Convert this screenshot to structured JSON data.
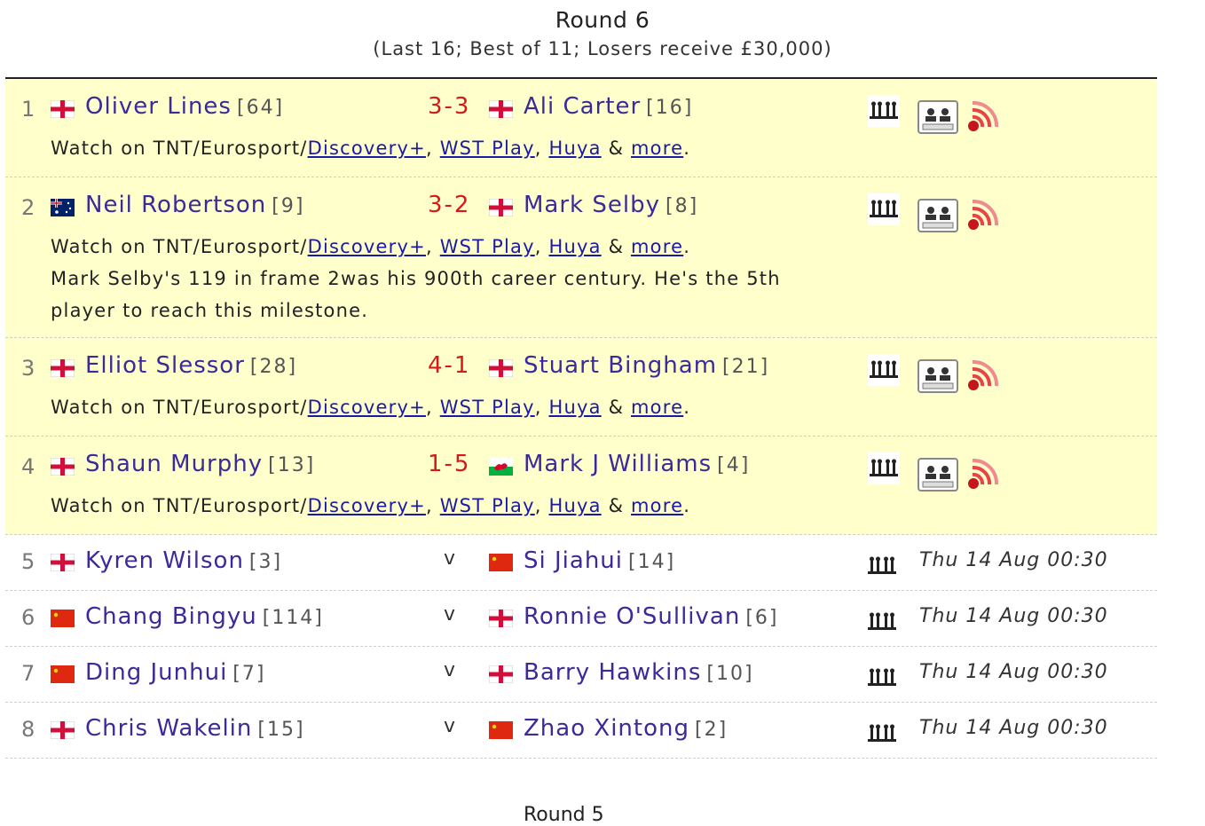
{
  "round": {
    "title": "Round 6",
    "subtitle": "(Last 16; Best of 11; Losers receive £30,000)",
    "next_title": "Round 5"
  },
  "colors": {
    "live_bg": "#ffffcc",
    "player": "#3a2a9a",
    "score": "#d41a1a",
    "link": "#1a1aa6"
  },
  "icons": {
    "h2h": "head-to-head-icon",
    "scorecard": "scorecard-icon",
    "live": "live-score-icon"
  },
  "watch": {
    "prefix": "Watch on TNT/Eurosport/",
    "links": [
      "Discovery+",
      "WST Play",
      "Huya",
      "more"
    ],
    "sep1": ", ",
    "sep2": ", ",
    "sep3": " & ",
    "end": "."
  },
  "matches": [
    {
      "num": "1",
      "player_a": "Oliver Lines",
      "seed_a": "[64]",
      "flag_a": "england",
      "score": "3-3",
      "player_b": "Ali Carter",
      "seed_b": "[16]",
      "flag_b": "england",
      "live": true
    },
    {
      "num": "2",
      "player_a": "Neil Robertson",
      "seed_a": "[9]",
      "flag_a": "australia",
      "score": "3-2",
      "player_b": "Mark Selby",
      "seed_b": "[8]",
      "flag_b": "england",
      "live": true,
      "note": "Mark Selby's 119 in frame 2was his 900th career century. He's the 5th player to reach this milestone."
    },
    {
      "num": "3",
      "player_a": "Elliot Slessor",
      "seed_a": "[28]",
      "flag_a": "england",
      "score": "4-1",
      "player_b": "Stuart Bingham",
      "seed_b": "[21]",
      "flag_b": "england",
      "live": true
    },
    {
      "num": "4",
      "player_a": "Shaun Murphy",
      "seed_a": "[13]",
      "flag_a": "england",
      "score": "1-5",
      "player_b": "Mark J Williams",
      "seed_b": "[4]",
      "flag_b": "wales",
      "live": true
    },
    {
      "num": "5",
      "player_a": "Kyren Wilson",
      "seed_a": "[3]",
      "flag_a": "england",
      "vs": "v",
      "player_b": "Si Jiahui",
      "seed_b": "[14]",
      "flag_b": "china",
      "time": "Thu 14 Aug 00:30"
    },
    {
      "num": "6",
      "player_a": "Chang Bingyu",
      "seed_a": "[114]",
      "flag_a": "china",
      "vs": "v",
      "player_b": "Ronnie O'Sullivan",
      "seed_b": "[6]",
      "flag_b": "england",
      "time": "Thu 14 Aug 00:30"
    },
    {
      "num": "7",
      "player_a": "Ding Junhui",
      "seed_a": "[7]",
      "flag_a": "china",
      "vs": "v",
      "player_b": "Barry Hawkins",
      "seed_b": "[10]",
      "flag_b": "england",
      "time": "Thu 14 Aug 00:30"
    },
    {
      "num": "8",
      "player_a": "Chris Wakelin",
      "seed_a": "[15]",
      "flag_a": "england",
      "vs": "v",
      "player_b": "Zhao Xintong",
      "seed_b": "[2]",
      "flag_b": "china",
      "time": "Thu 14 Aug 00:30"
    }
  ]
}
